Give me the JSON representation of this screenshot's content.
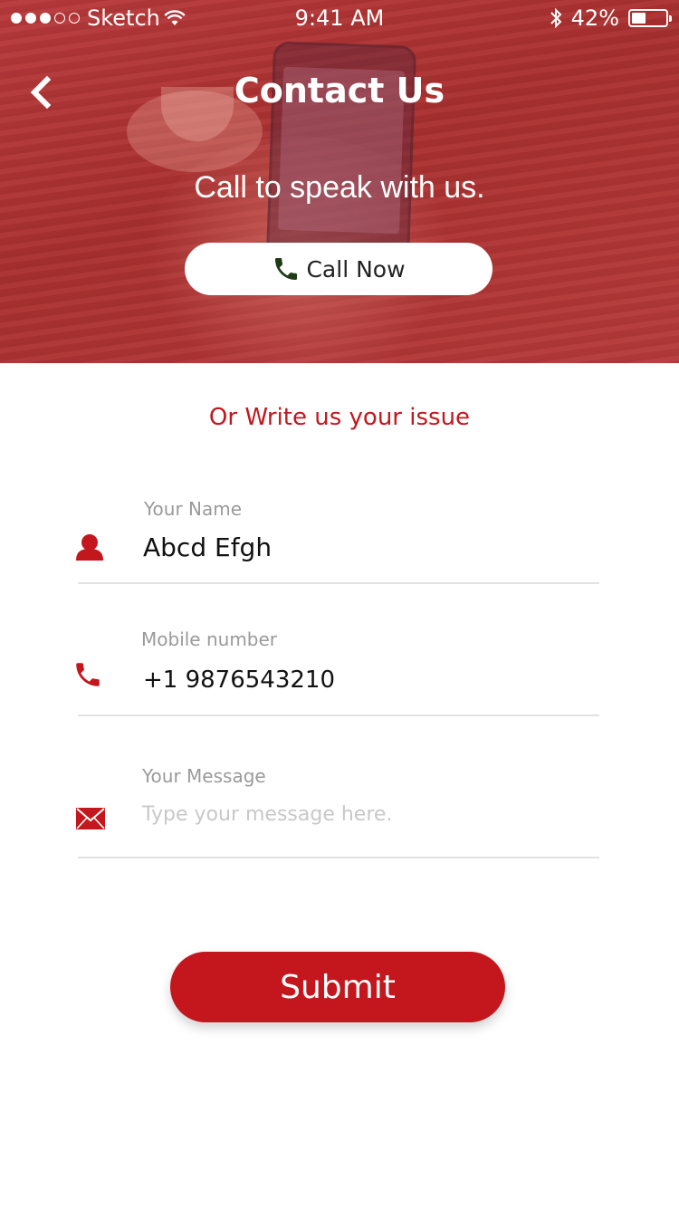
{
  "status_bar": {
    "carrier": "Sketch",
    "time": "9:41 AM",
    "battery": "42%",
    "battery_level": 0.42
  },
  "header": {
    "title": "Contact Us",
    "subtitle": "Call to speak with us.",
    "call_button": "Call Now"
  },
  "form": {
    "heading": "Or Write us your issue",
    "name": {
      "label": "Your Name",
      "value": "Abcd Efgh"
    },
    "mobile": {
      "label": "Mobile number",
      "value": "+1 9876543210"
    },
    "message": {
      "label": "Your Message",
      "placeholder": "Type your message here."
    },
    "submit": "Submit"
  },
  "colors": {
    "accent": "#c3171d",
    "hero_overlay": "#b2373a"
  },
  "icons": {
    "back": "chevron-left-icon",
    "call": "phone-icon",
    "name": "user-icon",
    "mobile": "phone-icon",
    "message": "envelope-icon"
  }
}
